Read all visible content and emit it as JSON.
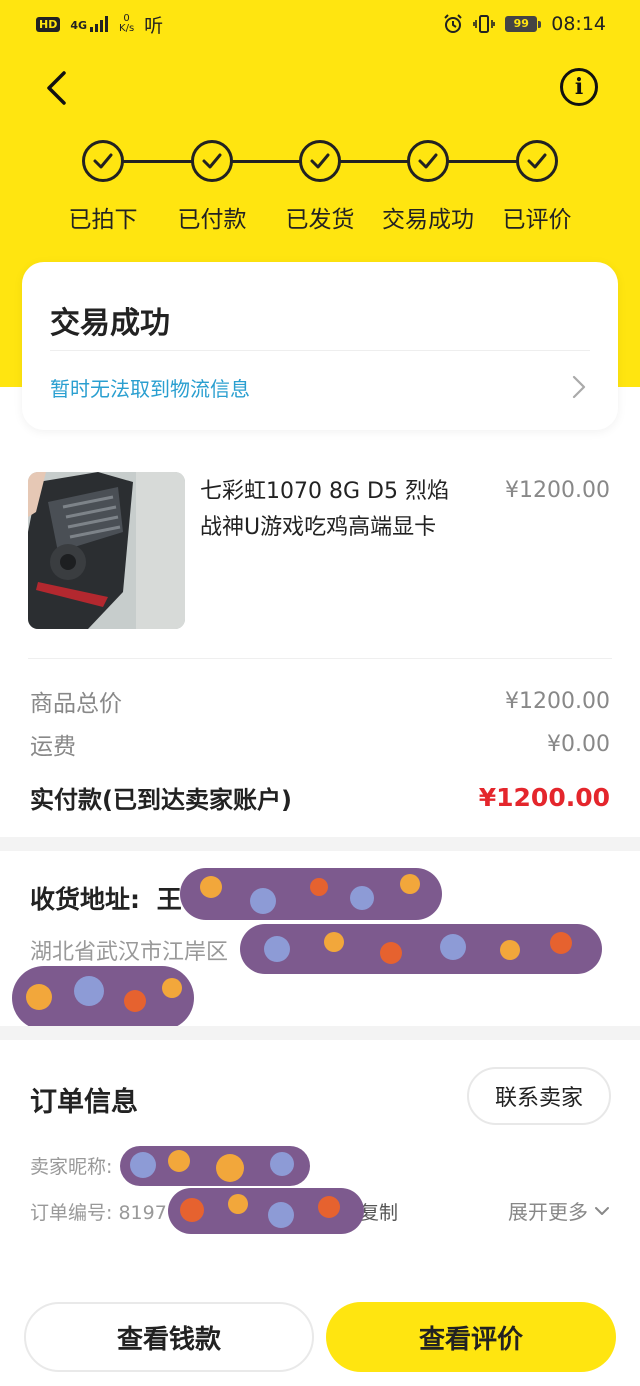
{
  "status_bar": {
    "hd": "HD",
    "network": "4G",
    "speed_value": "0",
    "speed_unit": "K/s",
    "extra_icon": "听",
    "battery": "99",
    "time": "08:14"
  },
  "nav": {
    "back_icon": "chevron-left-icon",
    "info_icon": "info-icon"
  },
  "progress": {
    "steps": [
      {
        "label": "已拍下",
        "done": true
      },
      {
        "label": "已付款",
        "done": true
      },
      {
        "label": "已发货",
        "done": true
      },
      {
        "label": "交易成功",
        "done": true
      },
      {
        "label": "已评价",
        "done": true
      }
    ]
  },
  "status_card": {
    "title": "交易成功",
    "logistics_text": "暂时无法取到物流信息"
  },
  "product": {
    "title_line1": "七彩虹1070 8G D5 烈焰",
    "title_line2": "战神U游戏吃鸡高端显卡",
    "price": "¥1200.00"
  },
  "fees": {
    "goods_total_label": "商品总价",
    "goods_total_value": "¥1200.00",
    "shipping_label": "运费",
    "shipping_value": "¥0.00",
    "paid_label": "实付款(已到达卖家账户)",
    "paid_value": "¥1200.00"
  },
  "address": {
    "label": "收货地址:",
    "name_visible": "王",
    "text_visible": "湖北省武汉市江岸区"
  },
  "order": {
    "title": "订单信息",
    "contact_button": "联系卖家",
    "seller_label": "卖家昵称:",
    "order_no_label": "订单编号: 8197",
    "copy_label": "复制",
    "expand_label": "展开更多"
  },
  "actions": {
    "view_money": "查看钱款",
    "view_review": "查看评价"
  },
  "colors": {
    "brand_yellow": "#ffe510",
    "price_red": "#e4262c",
    "link_blue": "#2a9fd0",
    "censor_purple": "#7d5a8e"
  }
}
